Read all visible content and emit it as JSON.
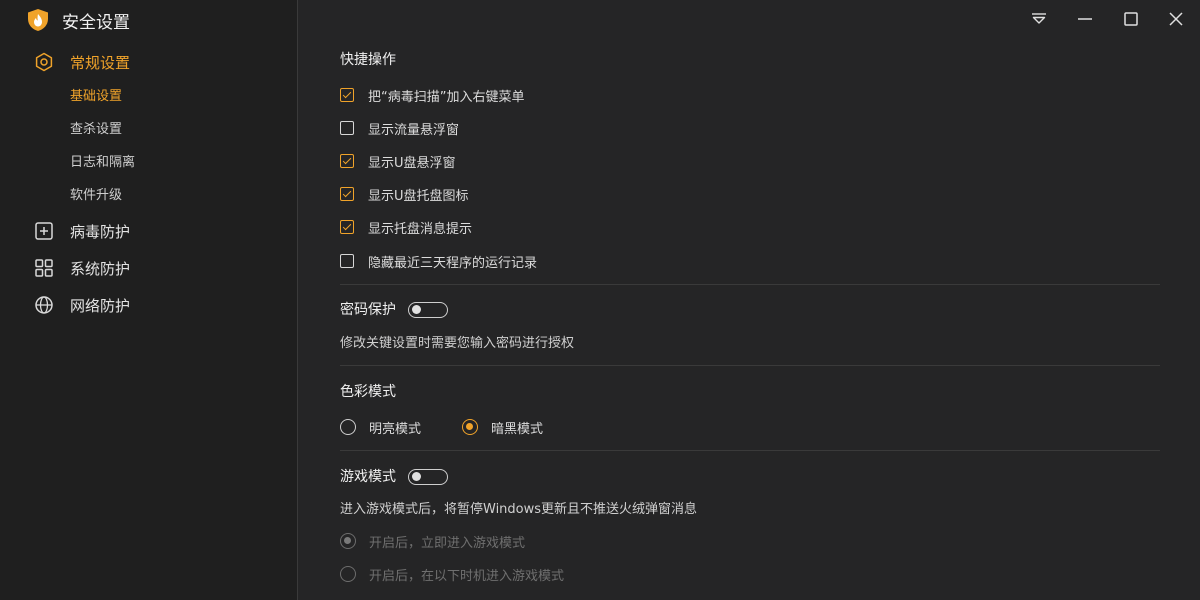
{
  "app": {
    "title": "安全设置"
  },
  "colors": {
    "accent": "#f0a32a",
    "sidebar_bg": "#1f1f1f",
    "content_bg": "#252526"
  },
  "sidebar": {
    "groups": [
      {
        "label": "常规设置",
        "icon": "gear-icon",
        "active": true
      },
      {
        "label": "病毒防护",
        "icon": "plus-square-icon"
      },
      {
        "label": "系统防护",
        "icon": "grid-icon"
      },
      {
        "label": "网络防护",
        "icon": "globe-icon"
      }
    ],
    "subitems": [
      {
        "label": "基础设置",
        "active": true
      },
      {
        "label": "查杀设置"
      },
      {
        "label": "日志和隔离"
      },
      {
        "label": "软件升级"
      }
    ]
  },
  "window_controls": [
    "dropdown-icon",
    "minimize-icon",
    "maximize-icon",
    "close-icon"
  ],
  "quick_ops": {
    "heading": "快捷操作",
    "items": [
      {
        "label": "把“病毒扫描”加入右键菜单",
        "checked": true
      },
      {
        "label": "显示流量悬浮窗",
        "checked": false
      },
      {
        "label": "显示U盘悬浮窗",
        "checked": true
      },
      {
        "label": "显示U盘托盘图标",
        "checked": true
      },
      {
        "label": "显示托盘消息提示",
        "checked": true
      },
      {
        "label": "隐藏最近三天程序的运行记录",
        "checked": false
      }
    ]
  },
  "password": {
    "heading": "密码保护",
    "enabled": false,
    "desc": "修改关键设置时需要您输入密码进行授权"
  },
  "color_mode": {
    "heading": "色彩模式",
    "options": [
      {
        "label": "明亮模式",
        "selected": false
      },
      {
        "label": "暗黑模式",
        "selected": true
      }
    ]
  },
  "game_mode": {
    "heading": "游戏模式",
    "enabled": false,
    "desc": "进入游戏模式后，将暂停Windows更新且不推送火绒弹窗消息",
    "options": [
      {
        "label": "开启后，立即进入游戏模式",
        "selected": true
      },
      {
        "label": "开启后，在以下时机进入游戏模式",
        "selected": false
      }
    ]
  }
}
